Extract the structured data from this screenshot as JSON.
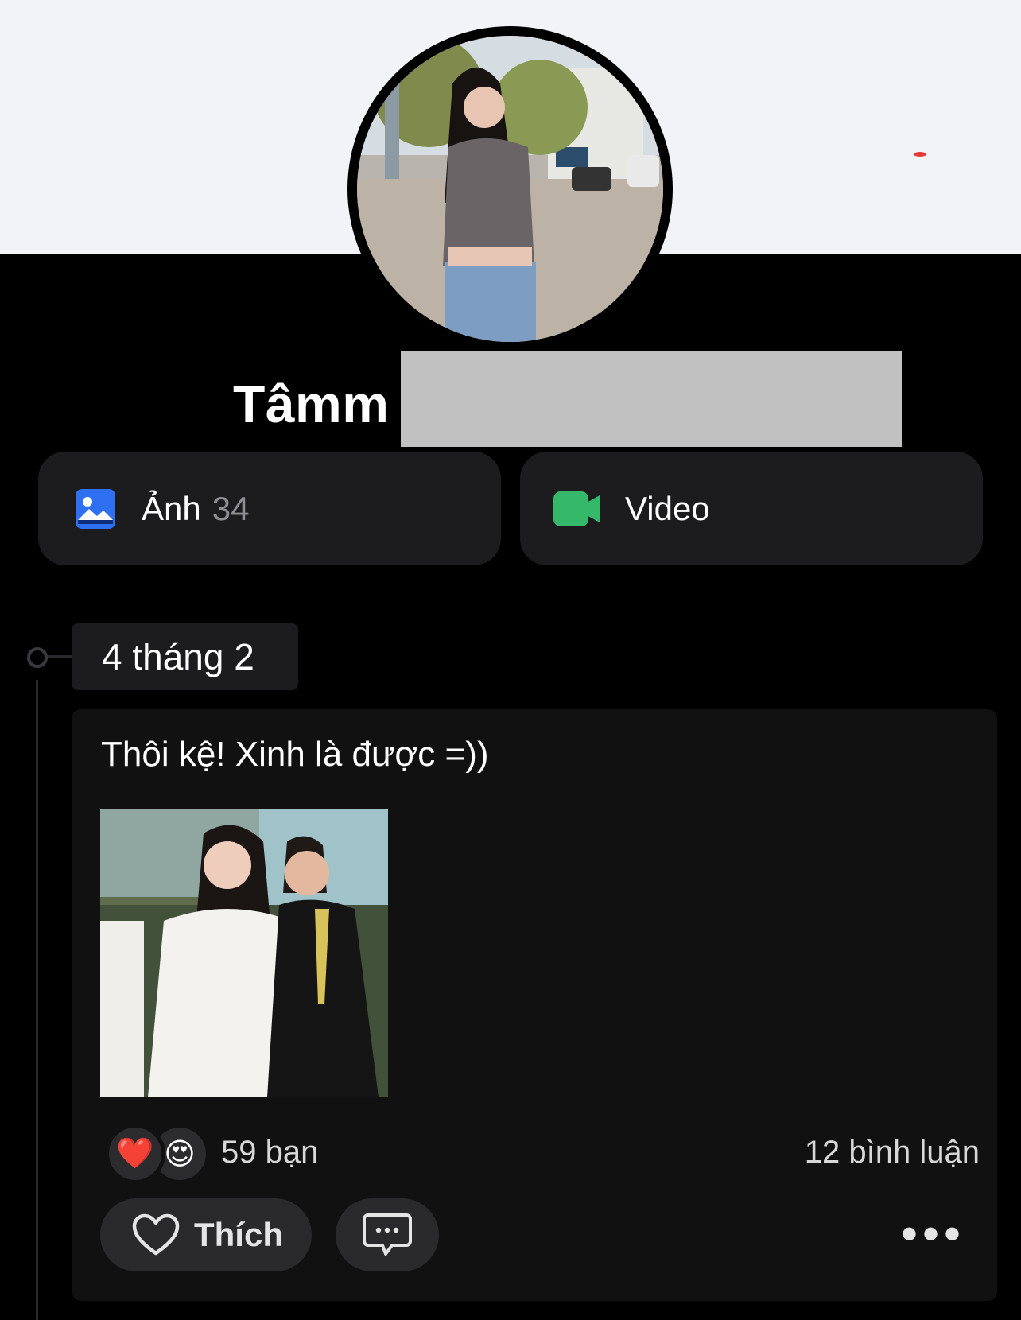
{
  "profile": {
    "name_visible": "Tâmm",
    "name_suffix_partial": "("
  },
  "media": {
    "photos_label": "Ảnh",
    "photos_count": "34",
    "video_label": "Video"
  },
  "post": {
    "date": "4 tháng 2",
    "text": "Thôi kệ! Xinh là được =))",
    "reaction_count_text": "59 bạn",
    "comment_count_text": "12 bình luận",
    "like_label": "Thích",
    "more_label": "•••"
  },
  "colors": {
    "photo_icon": "#2f6ff2",
    "video_icon": "#36b86a",
    "background": "#000000",
    "card": "#1c1c1e"
  },
  "icons": [
    "photo-icon",
    "video-camera-icon",
    "heart-outline-icon",
    "comment-icon",
    "more-icon",
    "heart-reaction-icon",
    "heart-eyes-reaction-icon"
  ]
}
